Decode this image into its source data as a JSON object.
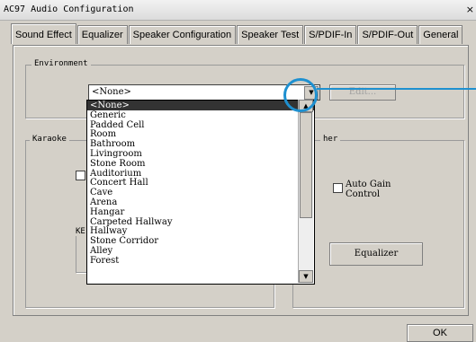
{
  "window": {
    "title": "AC97 Audio Configuration",
    "close_glyph": "×"
  },
  "tabs": [
    {
      "label": "Sound Effect"
    },
    {
      "label": "Equalizer"
    },
    {
      "label": "Speaker Configuration"
    },
    {
      "label": "Speaker Test"
    },
    {
      "label": "S/PDIF-In"
    },
    {
      "label": "S/PDIF-Out"
    },
    {
      "label": "General"
    }
  ],
  "environment": {
    "group_label": "Environment",
    "selected": "<None>",
    "edit_button": "Edit...",
    "options": [
      "<None>",
      "Generic",
      "Padded Cell",
      "Room",
      "Bathroom",
      "Livingroom",
      "Stone Room",
      "Auditorium",
      "Concert Hall",
      "Cave",
      "Arena",
      "Hangar",
      "Carpeted Hallway",
      "Hallway",
      "Stone Corridor",
      "Alley",
      "Forest"
    ]
  },
  "karaoke": {
    "group_label": "Karaoke",
    "key_label": "KE"
  },
  "other": {
    "group_label": "her",
    "auto_gain_line1": "Auto Gain",
    "auto_gain_line2": "Control",
    "equalizer_button": "Equalizer"
  },
  "footer": {
    "ok_button": "OK"
  },
  "colors": {
    "highlight": "#1e90d0"
  }
}
